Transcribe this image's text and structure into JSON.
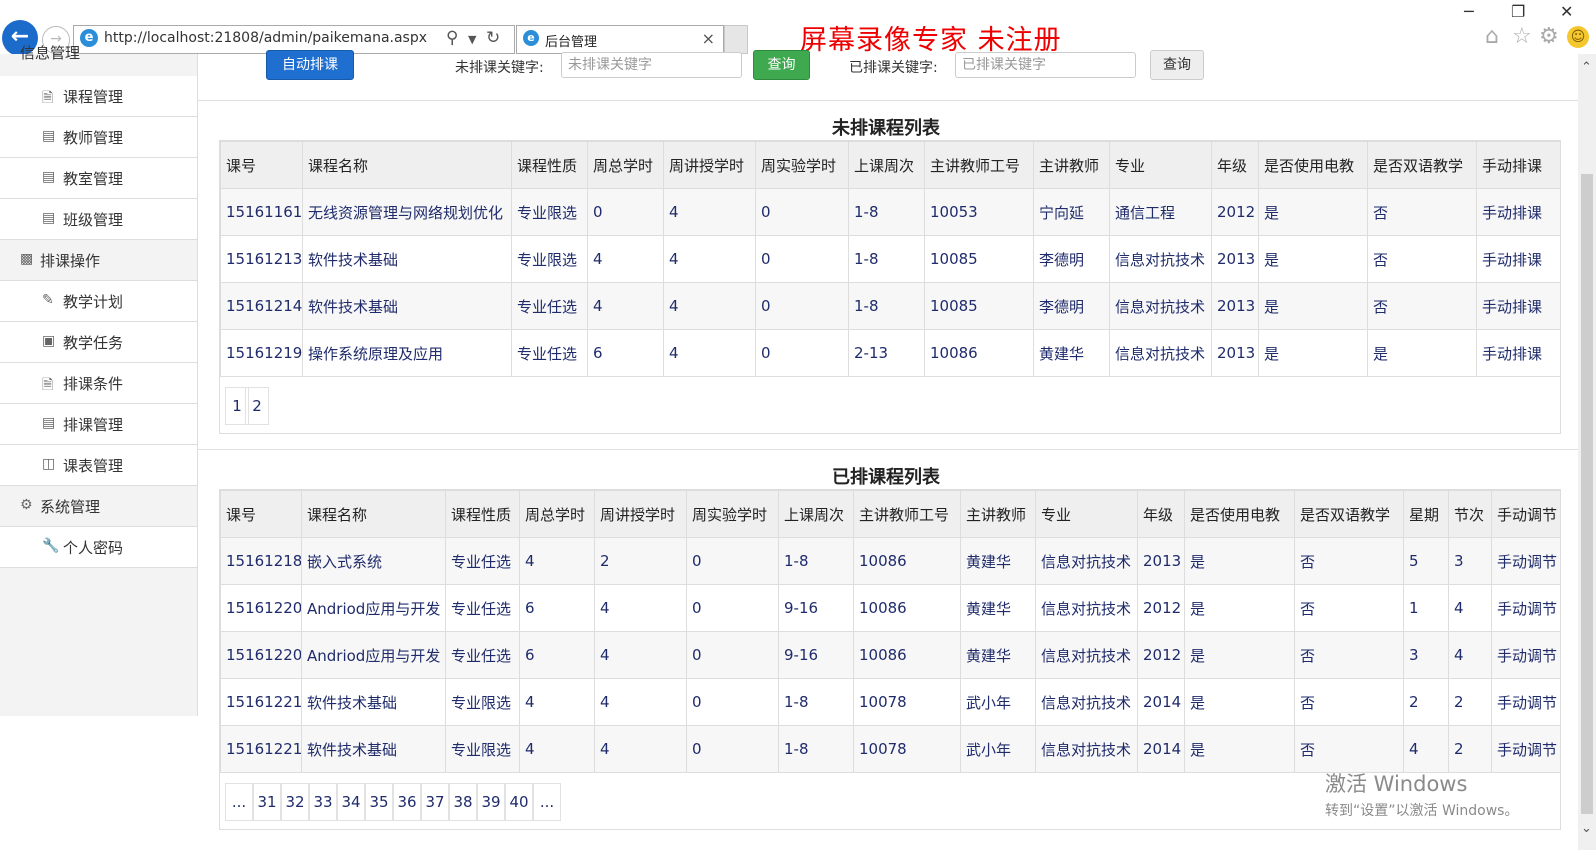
{
  "browser": {
    "url": "http://localhost:21808/admin/paikemana.aspx",
    "tab_title": "后台管理",
    "watermark": "屏幕录像专家  未注册",
    "minimize": "─",
    "restore": "❐",
    "close": "✕"
  },
  "sidebar": {
    "cut_label": "信息管理",
    "items": [
      {
        "label": "课程管理",
        "icon": "file-icon"
      },
      {
        "label": "教师管理",
        "icon": "list-icon"
      },
      {
        "label": "教室管理",
        "icon": "list-icon"
      },
      {
        "label": "班级管理",
        "icon": "list-icon"
      },
      {
        "label": "排课操作",
        "icon": "schedule-icon",
        "group": true
      },
      {
        "label": "教学计划",
        "icon": "pen-icon"
      },
      {
        "label": "教学任务",
        "icon": "image-icon"
      },
      {
        "label": "排课条件",
        "icon": "file-icon"
      },
      {
        "label": "排课管理",
        "icon": "list-icon"
      },
      {
        "label": "课表管理",
        "icon": "binoculars-icon"
      },
      {
        "label": "系统管理",
        "icon": "gear-icon",
        "group": true
      },
      {
        "label": "个人密码",
        "icon": "wrench-icon"
      }
    ]
  },
  "toolbar": {
    "auto_btn": "自动排课",
    "unscheduled_label": "未排课关键字:",
    "unscheduled_placeholder": "未排课关键字",
    "query1": "查询",
    "scheduled_label": "已排课关键字:",
    "scheduled_placeholder": "已排课关键字",
    "query2": "查询"
  },
  "unscheduled": {
    "title": "未排课程列表",
    "headers": [
      "课号",
      "课程名称",
      "课程性质",
      "周总学时",
      "周讲授学时",
      "周实验学时",
      "上课周次",
      "主讲教师工号",
      "主讲教师",
      "专业",
      "年级",
      "是否使用电教",
      "是否双语教学",
      "手动排课"
    ],
    "rows": [
      [
        "15161161",
        "无线资源管理与网络规划优化",
        "专业限选",
        "0",
        "4",
        "0",
        "1-8",
        "10053",
        "宁向延",
        "通信工程",
        "2012",
        "是",
        "否",
        "手动排课"
      ],
      [
        "15161213",
        "软件技术基础",
        "专业限选",
        "4",
        "4",
        "0",
        "1-8",
        "10085",
        "李德明",
        "信息对抗技术",
        "2013",
        "是",
        "否",
        "手动排课"
      ],
      [
        "15161214",
        "软件技术基础",
        "专业任选",
        "4",
        "4",
        "0",
        "1-8",
        "10085",
        "李德明",
        "信息对抗技术",
        "2013",
        "是",
        "否",
        "手动排课"
      ],
      [
        "15161219",
        "操作系统原理及应用",
        "专业任选",
        "6",
        "4",
        "0",
        "2-13",
        "10086",
        "黄建华",
        "信息对抗技术",
        "2013",
        "是",
        "是",
        "手动排课"
      ]
    ],
    "pages": [
      "1",
      "2"
    ]
  },
  "scheduled": {
    "title": "已排课程列表",
    "headers": [
      "课号",
      "课程名称",
      "课程性质",
      "周总学时",
      "周讲授学时",
      "周实验学时",
      "上课周次",
      "主讲教师工号",
      "主讲教师",
      "专业",
      "年级",
      "是否使用电教",
      "是否双语教学",
      "星期",
      "节次",
      "手动调节"
    ],
    "rows": [
      [
        "15161218",
        "嵌入式系统",
        "专业任选",
        "4",
        "2",
        "0",
        "1-8",
        "10086",
        "黄建华",
        "信息对抗技术",
        "2013",
        "是",
        "否",
        "5",
        "3",
        "手动调节"
      ],
      [
        "15161220",
        "Andriod应用与开发",
        "专业任选",
        "6",
        "4",
        "0",
        "9-16",
        "10086",
        "黄建华",
        "信息对抗技术",
        "2012",
        "是",
        "否",
        "1",
        "4",
        "手动调节"
      ],
      [
        "15161220",
        "Andriod应用与开发",
        "专业任选",
        "6",
        "4",
        "0",
        "9-16",
        "10086",
        "黄建华",
        "信息对抗技术",
        "2012",
        "是",
        "否",
        "3",
        "4",
        "手动调节"
      ],
      [
        "15161221",
        "软件技术基础",
        "专业限选",
        "4",
        "4",
        "0",
        "1-8",
        "10078",
        "武小年",
        "信息对抗技术",
        "2014",
        "是",
        "否",
        "2",
        "2",
        "手动调节"
      ],
      [
        "15161221",
        "软件技术基础",
        "专业限选",
        "4",
        "4",
        "0",
        "1-8",
        "10078",
        "武小年",
        "信息对抗技术",
        "2014",
        "是",
        "否",
        "4",
        "2",
        "手动调节"
      ]
    ],
    "pages": [
      "...",
      "31",
      "32",
      "33",
      "34",
      "35",
      "36",
      "37",
      "38",
      "39",
      "40",
      "..."
    ]
  },
  "activation": {
    "line1": "激活 Windows",
    "line2": "转到“设置”以激活 Windows。"
  }
}
